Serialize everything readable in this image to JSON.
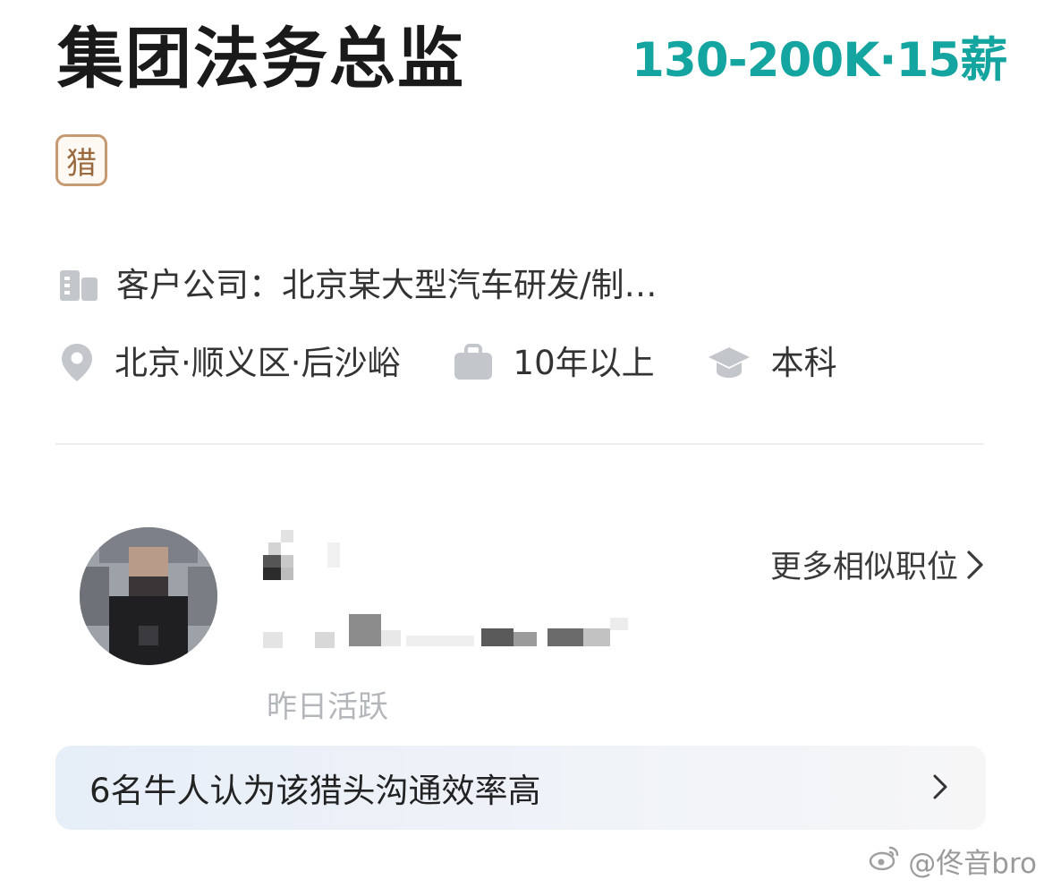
{
  "job": {
    "title": "集团法务总监",
    "salary": "130-200K·15薪",
    "tag": "猎"
  },
  "company": {
    "icon": "building-icon",
    "text": "客户公司：北京某大型汽车研发/制…"
  },
  "meta": [
    {
      "icon": "location-pin-icon",
      "text": "北京·顺义区·后沙峪"
    },
    {
      "icon": "briefcase-icon",
      "text": "10年以上"
    },
    {
      "icon": "graduation-cap-icon",
      "text": "本科"
    }
  ],
  "recruiter": {
    "active": "昨日活跃",
    "more_label": "更多相似职位"
  },
  "banner": {
    "text": "6名牛人认为该猎头沟通效率高"
  },
  "watermark": {
    "text": "@佟音bro"
  },
  "colors": {
    "salary": "#14a5a0",
    "tag_border": "#c69a72",
    "icon_gray": "#b9bcc1"
  }
}
